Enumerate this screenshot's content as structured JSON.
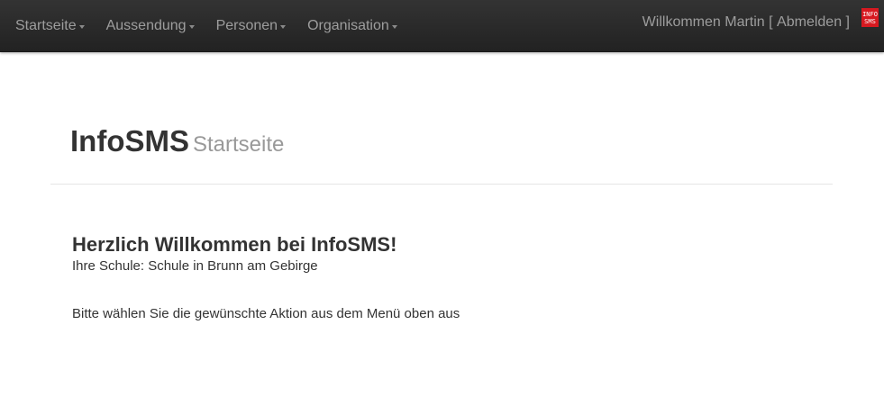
{
  "navbar": {
    "items": [
      {
        "label": "Startseite"
      },
      {
        "label": "Aussendung"
      },
      {
        "label": "Personen"
      },
      {
        "label": "Organisation"
      }
    ],
    "welcome_text": "Willkommen Martin",
    "bracket_open": "[",
    "logout_label": "Abmelden",
    "bracket_close": "]",
    "logo_line1": "INFO",
    "logo_line2": "SMS"
  },
  "header": {
    "brand": "InfoSMS",
    "subtitle": "Startseite"
  },
  "main": {
    "greeting": "Herzlich Willkommen bei InfoSMS!",
    "school_line": "Ihre Schule: Schule in Brunn am Gebirge",
    "instruction": "Bitte wählen Sie die gewünschte Aktion aus dem Menü oben aus"
  },
  "colors": {
    "navbar_bg": "#222222",
    "nav_text": "#9d9d9d",
    "logo_red": "#d71920",
    "text": "#333333",
    "muted": "#999999"
  }
}
